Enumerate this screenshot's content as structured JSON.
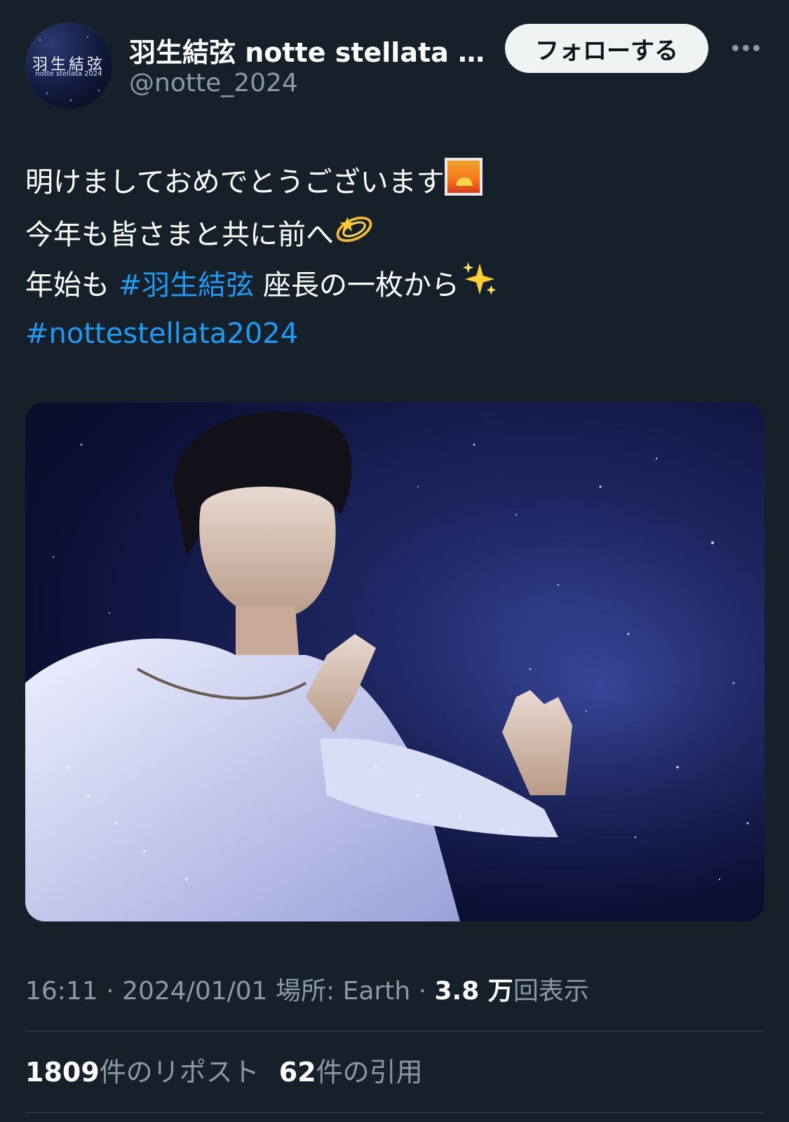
{
  "header": {
    "avatar": {
      "title": "羽生結弦",
      "subtitle": "notte stellata 2024"
    },
    "display_name": "羽生結弦 notte stellata 2…",
    "handle": "@notte_2024",
    "follow_label": "フォローする",
    "more_icon": "more-horizontal-icon"
  },
  "tweet": {
    "line1": "明けましておめでとうございます",
    "line1_emoji": "sunrise-emoji",
    "line2": "今年も皆さまと共に前へ",
    "line2_emoji": "dizzy-emoji",
    "line3_before": "年始も ",
    "line3_hashtag": "#羽生結弦",
    "line3_after": " 座長の一枚から",
    "line3_emoji": "sparkles-emoji",
    "line4_hashtag": "#nottestellata2024"
  },
  "media": {
    "kind": "photo"
  },
  "meta": {
    "time": "16:11",
    "sep1": " · ",
    "date": "2024/01/01",
    "location_label": " 場所: Earth",
    "sep2": " · ",
    "views_count": "3.8 万",
    "views_label": "回表示"
  },
  "stats": {
    "reposts_count": "1809",
    "reposts_label": "件のリポスト",
    "quotes_count": "62",
    "quotes_label": "件の引用"
  },
  "colors": {
    "background": "#15202b",
    "link": "#1d9bf0",
    "secondary_text": "#8b98a5",
    "divider": "#38444d",
    "follow_bg": "#eff3f4"
  }
}
